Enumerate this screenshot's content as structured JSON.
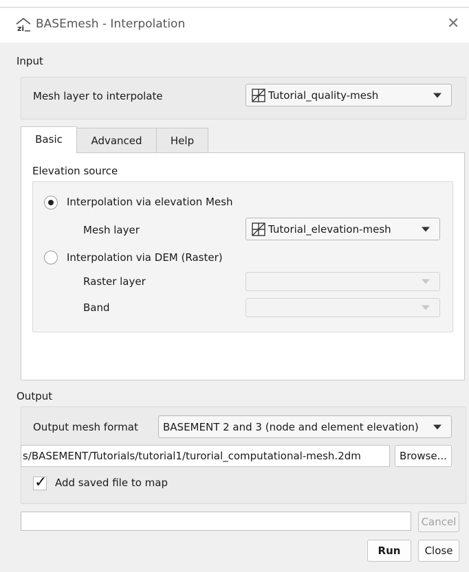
{
  "window": {
    "title": "BASEmesh - Interpolation",
    "app_icon": "basemesh-app-icon",
    "close_glyph": "✕"
  },
  "input": {
    "section_label": "Input",
    "mesh_layer_label": "Mesh layer to interpolate",
    "mesh_layer_value": "Tutorial_quality-mesh"
  },
  "tabs": [
    {
      "label": "Basic",
      "active": true
    },
    {
      "label": "Advanced",
      "active": false
    },
    {
      "label": "Help",
      "active": false
    }
  ],
  "basic": {
    "elevation_source_label": "Elevation source",
    "option_mesh_label": "Interpolation via elevation Mesh",
    "option_mesh_selected": true,
    "mesh_layer_label": "Mesh layer",
    "mesh_layer_value": "Tutorial_elevation-mesh",
    "option_dem_label": "Interpolation via DEM (Raster)",
    "option_dem_selected": false,
    "raster_layer_label": "Raster layer",
    "raster_layer_value": "",
    "band_label": "Band",
    "band_value": ""
  },
  "output": {
    "section_label": "Output",
    "format_label": "Output mesh format",
    "format_value": "BASEMENT 2 and 3 (node and element elevation)",
    "path_value": "s/BASEMENT/Tutorials/tutorial1/turorial_computational-mesh.2dm",
    "browse_label": "Browse...",
    "add_to_map_label": "Add saved file to map",
    "add_to_map_checked": true,
    "check_glyph": "✓"
  },
  "footer": {
    "progress_percent": 0,
    "cancel_label": "Cancel",
    "run_label": "Run",
    "close_label": "Close"
  },
  "colors": {
    "background": "#f0f0f0",
    "group_background": "#ebebeb",
    "panel_background": "#ffffff",
    "disabled_text": "#a0a0a0"
  }
}
